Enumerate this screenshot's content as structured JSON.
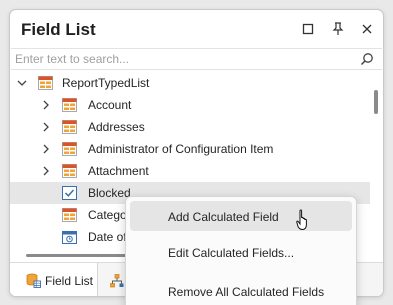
{
  "panel": {
    "title": "Field List",
    "buttons": [
      "maximize-icon",
      "pin-icon",
      "close-icon"
    ]
  },
  "search": {
    "placeholder": "Enter text to search..."
  },
  "tree": {
    "root": {
      "label": "ReportTypedList",
      "icon": "table-icon"
    },
    "items": [
      {
        "label": "Account",
        "icon": "table-icon"
      },
      {
        "label": "Addresses",
        "icon": "table-icon"
      },
      {
        "label": "Administrator of Configuration Item",
        "icon": "table-icon"
      },
      {
        "label": "Attachment",
        "icon": "table-icon"
      },
      {
        "label": "Blocked",
        "icon": "checkbox-field-icon"
      },
      {
        "label": "Category",
        "icon": "table-icon"
      },
      {
        "label": "Date of",
        "icon": "calendar-field-icon"
      }
    ]
  },
  "tabs": [
    {
      "label": "Field List",
      "icon": "database-icon"
    },
    {
      "label": "",
      "icon": "report-explorer-icon"
    }
  ],
  "context_menu": {
    "items": [
      "Add Calculated Field",
      "Edit Calculated Fields...",
      "Remove All Calculated Fields"
    ]
  },
  "colors": {
    "table_header": "#d9532b",
    "table_body": "#f0a436",
    "tree_icon_blue": "#3a6fb0"
  }
}
